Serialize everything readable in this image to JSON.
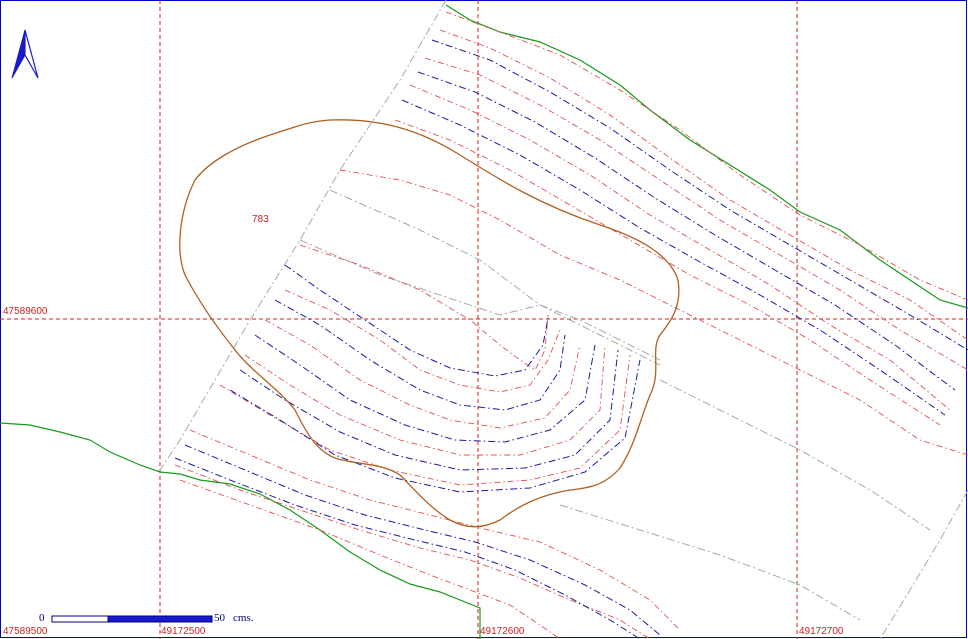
{
  "map": {
    "parcel_label": "783",
    "grid_labels": {
      "y_mid": "47589600",
      "y_bottom": "47589500",
      "x_1": "49172500",
      "x_2": "49172600",
      "x_3": "49172700"
    },
    "scale_bar": {
      "start_label": "0",
      "end_label": "50",
      "unit_label": "cms."
    },
    "north_arrow": "north-arrow-icon",
    "colors": {
      "border": "#0000cc",
      "grid": "#cc2222",
      "contour_red": "#e05050",
      "contour_blue": "#1a1aa0",
      "contour_gray": "#a8a8a8",
      "boundary_green": "#1a9a1a",
      "parcel_outline": "#b06020"
    }
  }
}
